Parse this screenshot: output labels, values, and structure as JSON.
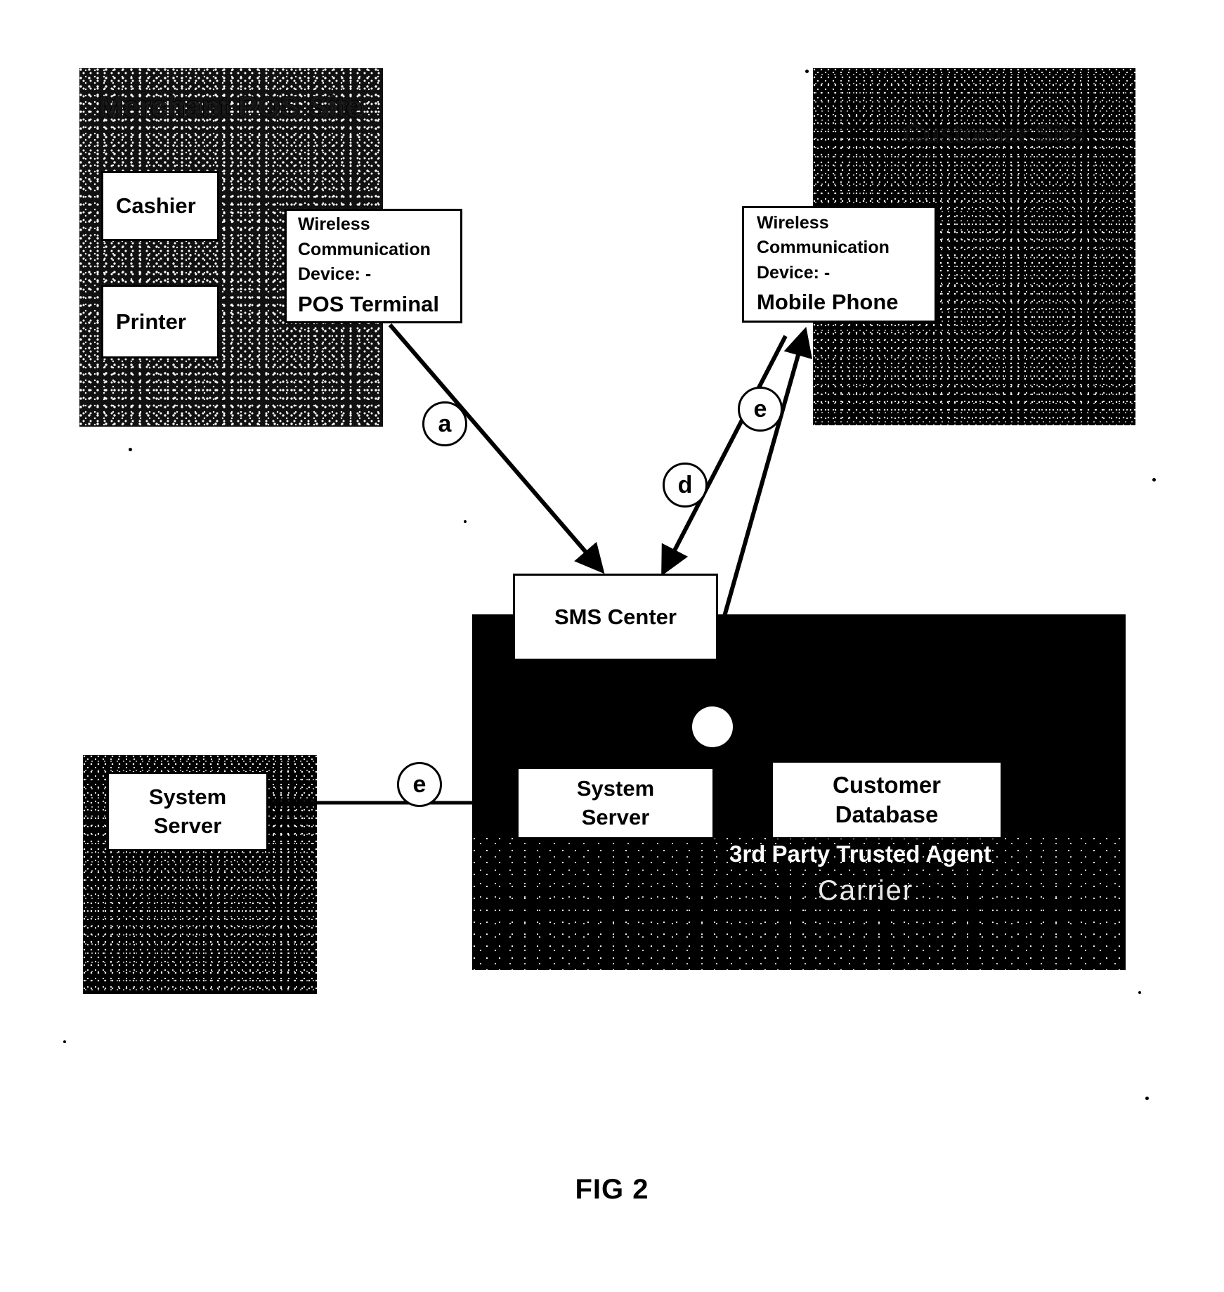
{
  "figure": {
    "caption": "FIG 2"
  },
  "regions": {
    "merchant_site": {
      "title": "Merchant POS Site",
      "nodes": [
        {
          "label": "Cashier"
        },
        {
          "label": "Printer"
        }
      ]
    },
    "customer_site": {
      "title": "Customer Site"
    },
    "system_operator": {
      "node": {
        "line1": "System",
        "line2": "Server"
      }
    },
    "carrier": {
      "title_agent": "3rd Party Trusted Agent",
      "title_carrier": "Carrier",
      "nodes": [
        {
          "line1": "System",
          "line2": "Server"
        },
        {
          "line1": "Customer",
          "line2": "Database"
        }
      ]
    }
  },
  "nodes": {
    "pos_terminal": {
      "line1": "Wireless",
      "line2": "Communication",
      "line3": "Device: -",
      "line4": "POS Terminal"
    },
    "mobile_phone": {
      "line1": "Wireless",
      "line2": "Communication",
      "line3": "Device: -",
      "line4": "Mobile Phone"
    },
    "sms_center": {
      "label": "SMS Center"
    }
  },
  "edges": [
    {
      "id": "a",
      "label": "a",
      "from": "pos-terminal",
      "to": "sms-center"
    },
    {
      "id": "d",
      "label": "d",
      "from": "sms-center",
      "to": "mobile-phone"
    },
    {
      "id": "e_top",
      "label": "e",
      "from": "mobile-phone",
      "to": "sms-center"
    },
    {
      "id": "e_left",
      "label": "e",
      "from": "system-server-operator",
      "to": "carrier-region"
    }
  ],
  "colors": {
    "ink": "#000000",
    "paper": "#ffffff",
    "region_fill": "#000000"
  }
}
